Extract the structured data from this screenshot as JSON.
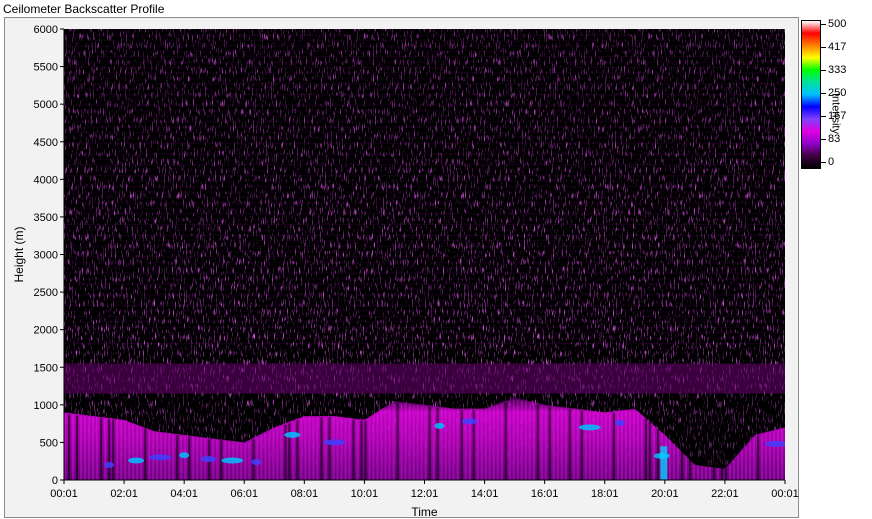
{
  "window": {
    "title": "Ceilometer Backscatter Profile"
  },
  "chart_data": {
    "type": "heatmap",
    "title": "Ceilometer Backscatter Profile",
    "xlabel": "Time",
    "ylabel": "Height (m)",
    "x_ticks": [
      "00:01",
      "02:01",
      "04:01",
      "06:01",
      "08:01",
      "10:01",
      "12:01",
      "14:01",
      "16:01",
      "18:01",
      "20:01",
      "22:01",
      "00:01"
    ],
    "y_ticks": [
      0,
      500,
      1000,
      1500,
      2000,
      2500,
      3000,
      3500,
      4000,
      4500,
      5000,
      5500,
      6000
    ],
    "ylim": [
      0,
      6000
    ],
    "xlim_hours": [
      0,
      24
    ],
    "grid": false,
    "colorbar": {
      "title": "Intensity",
      "ticks": [
        500,
        417,
        333,
        250,
        167,
        83,
        0
      ],
      "range": [
        0,
        500
      ],
      "colors": [
        "#000000",
        "#400040",
        "#9000c8",
        "#e000e0",
        "#8040ff",
        "#0000ff",
        "#00c0ff",
        "#00e0a0",
        "#00ff00",
        "#ffff00",
        "#ff8000",
        "#ff0000",
        "#ffffff"
      ]
    },
    "boundary_layer_top_m": [
      {
        "t": 0.0,
        "h": 900
      },
      {
        "t": 1.0,
        "h": 850
      },
      {
        "t": 2.0,
        "h": 800
      },
      {
        "t": 3.0,
        "h": 650
      },
      {
        "t": 4.0,
        "h": 600
      },
      {
        "t": 5.0,
        "h": 550
      },
      {
        "t": 6.0,
        "h": 500
      },
      {
        "t": 7.0,
        "h": 700
      },
      {
        "t": 8.0,
        "h": 850
      },
      {
        "t": 9.0,
        "h": 850
      },
      {
        "t": 10.0,
        "h": 800
      },
      {
        "t": 11.0,
        "h": 1050
      },
      {
        "t": 12.0,
        "h": 1000
      },
      {
        "t": 13.0,
        "h": 950
      },
      {
        "t": 14.0,
        "h": 950
      },
      {
        "t": 15.0,
        "h": 1100
      },
      {
        "t": 16.0,
        "h": 1000
      },
      {
        "t": 17.0,
        "h": 950
      },
      {
        "t": 18.0,
        "h": 900
      },
      {
        "t": 19.0,
        "h": 950
      },
      {
        "t": 20.0,
        "h": 600
      },
      {
        "t": 21.0,
        "h": 200
      },
      {
        "t": 22.0,
        "h": 150
      },
      {
        "t": 23.0,
        "h": 600
      },
      {
        "t": 24.0,
        "h": 700
      }
    ]
  }
}
